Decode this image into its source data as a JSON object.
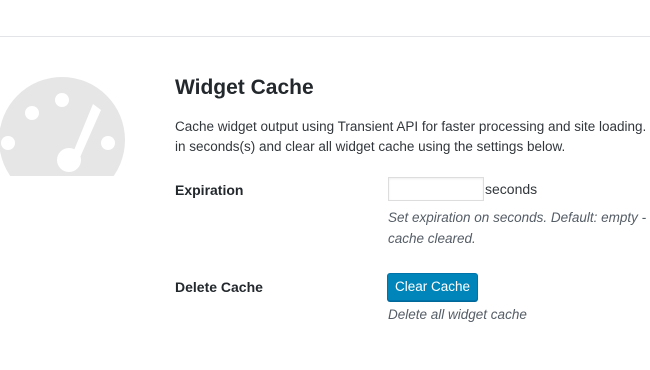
{
  "colors": {
    "background": "#ffffff",
    "divider": "#e2e4e7",
    "dashboard_icon": "#e6e6e6",
    "primary_button": "#0085ba",
    "text": "#23282d",
    "help_text": "#555d66"
  },
  "icon": "dashboard-gauge-icon",
  "section": {
    "title": "Widget Cache",
    "description_line1": "Cache widget output using Transient API for faster processing and site loading. You",
    "description_line2": "in seconds(s) and clear all widget cache using the settings below."
  },
  "expiration": {
    "label": "Expiration",
    "value": "",
    "placeholder": "",
    "unit": "seconds",
    "help_line1": "Set expiration on seconds. Default: empty -",
    "help_line2": "cache cleared."
  },
  "delete_cache": {
    "label": "Delete Cache",
    "button_label": "Clear Cache",
    "help": "Delete all widget cache"
  }
}
